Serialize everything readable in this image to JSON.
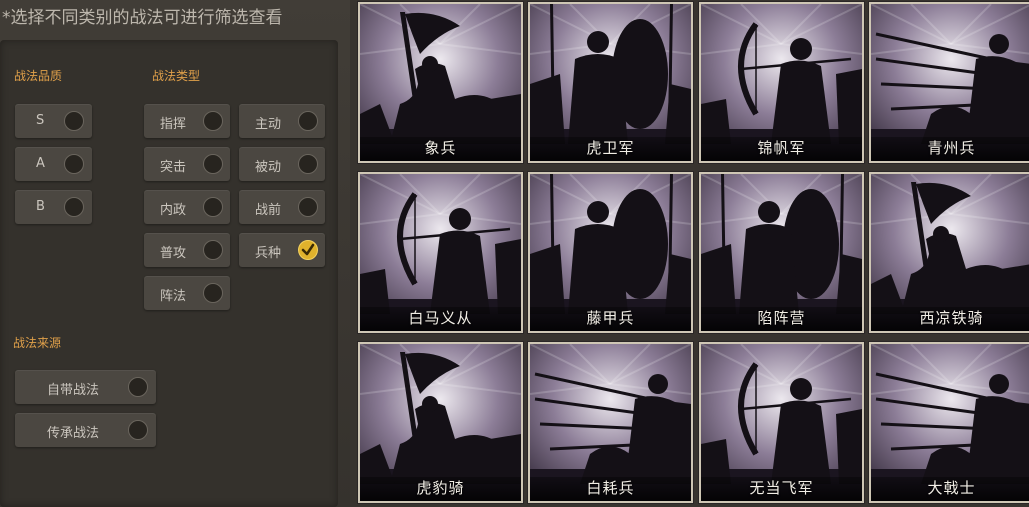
{
  "hint": "*选择不同类别的战法可进行筛选查看",
  "quality": {
    "title": "战法品质",
    "options": [
      {
        "label": "S",
        "checked": false
      },
      {
        "label": "A",
        "checked": false
      },
      {
        "label": "B",
        "checked": false
      }
    ]
  },
  "type": {
    "title": "战法类型",
    "options": [
      {
        "label": "指挥",
        "checked": false
      },
      {
        "label": "主动",
        "checked": false
      },
      {
        "label": "突击",
        "checked": false
      },
      {
        "label": "被动",
        "checked": false
      },
      {
        "label": "内政",
        "checked": false
      },
      {
        "label": "战前",
        "checked": false
      },
      {
        "label": "普攻",
        "checked": false
      },
      {
        "label": "兵种",
        "checked": true
      },
      {
        "label": "阵法",
        "checked": false
      }
    ]
  },
  "source": {
    "title": "战法来源",
    "options": [
      {
        "label": "自带战法",
        "checked": false
      },
      {
        "label": "传承战法",
        "checked": false
      }
    ]
  },
  "cards": [
    {
      "name": "象兵",
      "art": "flag-rider"
    },
    {
      "name": "虎卫军",
      "art": "shield-soldier"
    },
    {
      "name": "锦帆军",
      "art": "archer"
    },
    {
      "name": "青州兵",
      "art": "spear-charge"
    },
    {
      "name": "白马义从",
      "art": "archer"
    },
    {
      "name": "藤甲兵",
      "art": "shield-soldier"
    },
    {
      "name": "陷阵营",
      "art": "shield-soldier"
    },
    {
      "name": "西凉铁骑",
      "art": "flag-rider"
    },
    {
      "name": "虎豹骑",
      "art": "flag-rider"
    },
    {
      "name": "白耗兵",
      "art": "spear-charge"
    },
    {
      "name": "无当飞军",
      "art": "archer"
    },
    {
      "name": "大戟士",
      "art": "spear-charge"
    }
  ],
  "colors": {
    "accent": "#e0a04a",
    "check": "#e0b22c",
    "card_border": "#cfc7b5"
  }
}
